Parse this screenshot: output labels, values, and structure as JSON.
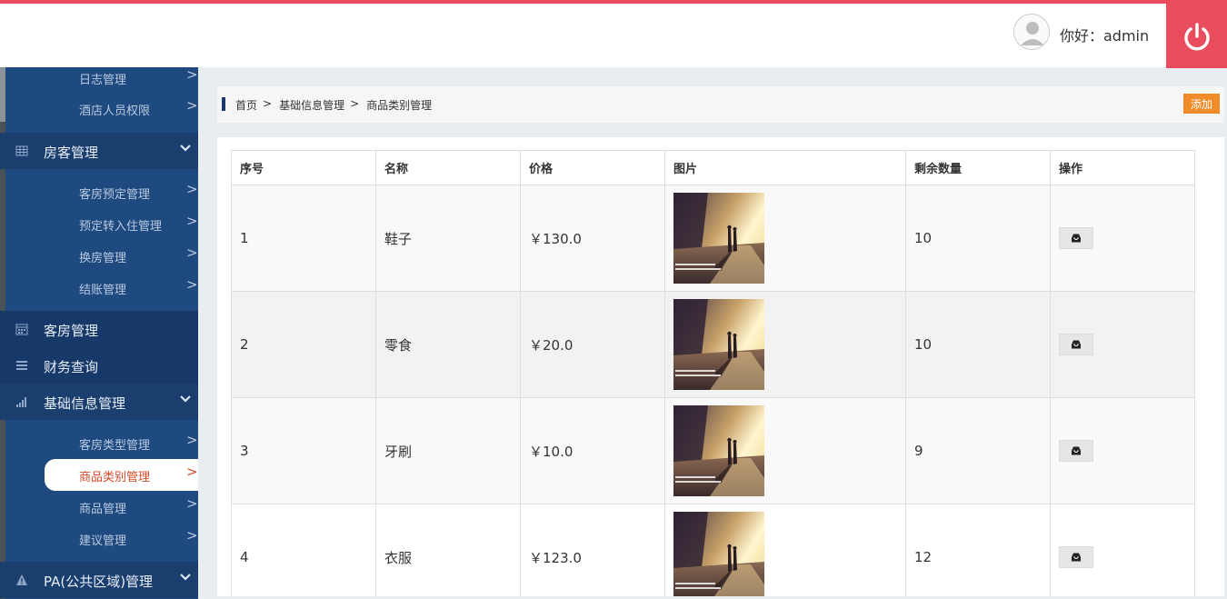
{
  "header": {
    "greeting": "你好：admin",
    "avatar_icon": "user-icon",
    "logout_icon": "power-icon",
    "accent": "#e84c5d"
  },
  "sidebar": {
    "items_top": [
      {
        "label": "日志管理",
        "arrow": ">"
      },
      {
        "label": "酒店人员权限",
        "arrow": ">"
      }
    ],
    "group_guest": {
      "label": "房客管理",
      "icon": "grid-icon"
    },
    "items_guest": [
      {
        "label": "客房预定管理",
        "arrow": ">"
      },
      {
        "label": "预定转入住管理",
        "arrow": ">"
      },
      {
        "label": "换房管理",
        "arrow": ">"
      },
      {
        "label": "结账管理",
        "arrow": ">"
      }
    ],
    "group_room": {
      "label": "客房管理",
      "icon": "calendar-icon"
    },
    "group_finance": {
      "label": "财务查询",
      "icon": "list-icon"
    },
    "group_basic": {
      "label": "基础信息管理",
      "icon": "signal-icon"
    },
    "items_basic": [
      {
        "label": "客房类型管理",
        "arrow": ">"
      },
      {
        "label": "商品类别管理",
        "arrow": ">"
      },
      {
        "label": "商品管理",
        "arrow": ">"
      },
      {
        "label": "建议管理",
        "arrow": ">"
      }
    ],
    "group_pa": {
      "label": "PA(公共区域)管理",
      "icon": "warning-icon"
    },
    "active_color": "#d84b2a"
  },
  "breadcrumb": {
    "home": "首页",
    "sep": ">",
    "level1": "基础信息管理",
    "level2": "商品类别管理"
  },
  "toolbar": {
    "add_label": "添加"
  },
  "table": {
    "headers": [
      "序号",
      "名称",
      "价格",
      "图片",
      "剩余数量",
      "操作"
    ],
    "rows": [
      {
        "id": "1",
        "name": "鞋子",
        "price": "￥130.0",
        "stock": "10"
      },
      {
        "id": "2",
        "name": "零食",
        "price": "￥20.0",
        "stock": "10"
      },
      {
        "id": "3",
        "name": "牙刷",
        "price": "￥10.0",
        "stock": "9"
      },
      {
        "id": "4",
        "name": "衣服",
        "price": "￥123.0",
        "stock": "12"
      }
    ],
    "operation_icon": "inbox-icon"
  }
}
